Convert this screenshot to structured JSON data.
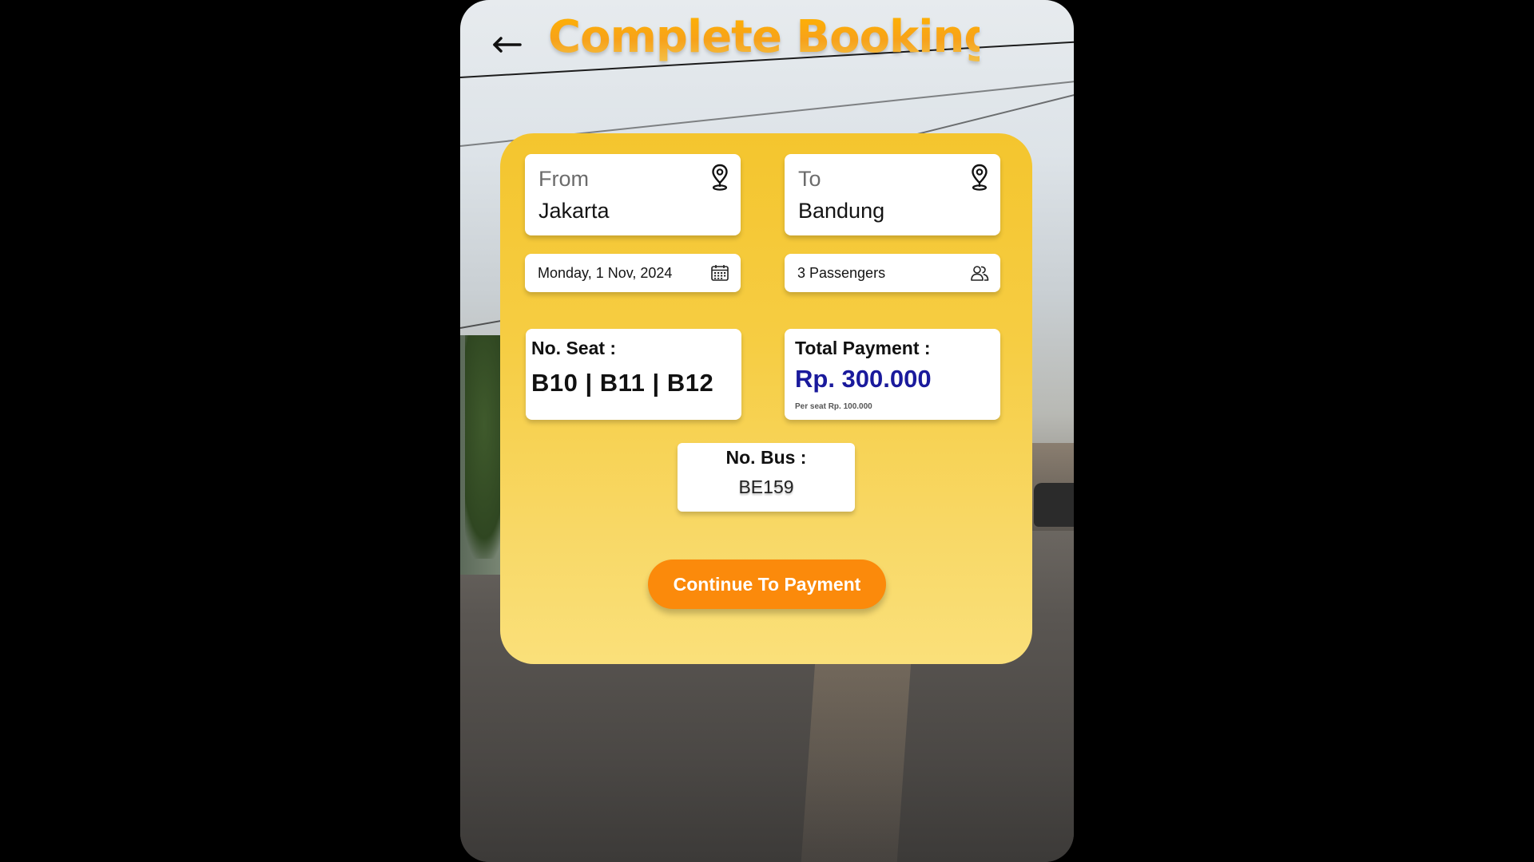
{
  "header": {
    "title": "Complete Booking",
    "back_icon": "arrow-left-icon"
  },
  "route": {
    "from_label": "From",
    "from_value": "Jakarta",
    "to_label": "To",
    "to_value": "Bandung",
    "location_icon": "map-pin-icon"
  },
  "trip": {
    "date": "Monday, 1 Nov, 2024",
    "date_icon": "calendar-icon",
    "passengers": "3 Passengers",
    "passengers_icon": "users-icon"
  },
  "seat": {
    "label": "No. Seat :",
    "value": "B10 | B11 | B12"
  },
  "payment": {
    "label": "Total Payment :",
    "value": "Rp. 300.000",
    "per_seat": "Per seat Rp. 100.000",
    "value_color": "#1a1a9c"
  },
  "bus": {
    "label": "No. Bus :",
    "value": "BE159"
  },
  "actions": {
    "continue_label": "Continue To Payment"
  },
  "colors": {
    "accent": "#fb8a0b",
    "card_top": "#f4c52e",
    "card_bottom": "#fae07a",
    "title": "#f5a011"
  }
}
